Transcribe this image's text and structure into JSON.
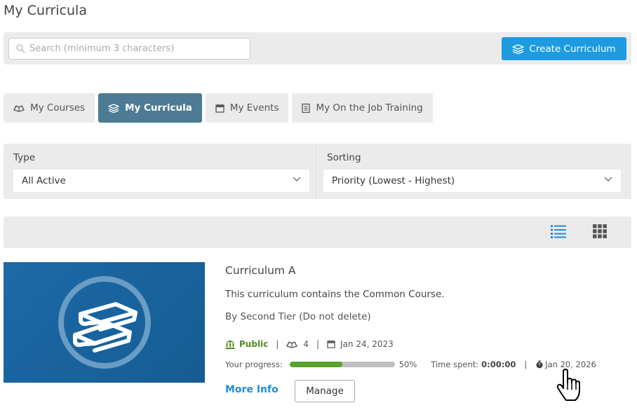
{
  "page": {
    "title": "My Curricula"
  },
  "search": {
    "placeholder": "Search (minimum 3 characters)"
  },
  "toolbar": {
    "create_label": "Create Curriculum"
  },
  "tabs": [
    {
      "label": "My Courses",
      "icon": "books-icon",
      "active": false
    },
    {
      "label": "My Curricula",
      "icon": "curriculum-icon",
      "active": true
    },
    {
      "label": "My Events",
      "icon": "calendar-icon",
      "active": false
    },
    {
      "label": "My On the Job Training",
      "icon": "clipboard-icon",
      "active": false
    }
  ],
  "filters": {
    "type": {
      "label": "Type",
      "value": "All Active"
    },
    "sorting": {
      "label": "Sorting",
      "value": "Priority (Lowest - Highest)"
    }
  },
  "view": {
    "active": "list",
    "options": [
      "list",
      "grid"
    ]
  },
  "curriculum": {
    "title": "Curriculum A",
    "description": "This curriculum contains the Common Course.",
    "author": "By Second Tier (Do not delete)",
    "visibility": "Public",
    "course_count": "4",
    "created": "Jan 24, 2023",
    "progress_label": "Your progress:",
    "progress_value": 50,
    "progress_text": "50%",
    "time_spent_label": "Time spent:",
    "time_spent": "0:00:00",
    "due_date": "Jan 20, 2026",
    "more_info_label": "More Info",
    "manage_label": "Manage"
  },
  "colors": {
    "accent": "#1e9be0",
    "active_tab": "#4c7b93",
    "public": "#4f8c1e",
    "progress": "#58a12a",
    "link": "#1e8ed6",
    "panel": "#ebebeb"
  }
}
